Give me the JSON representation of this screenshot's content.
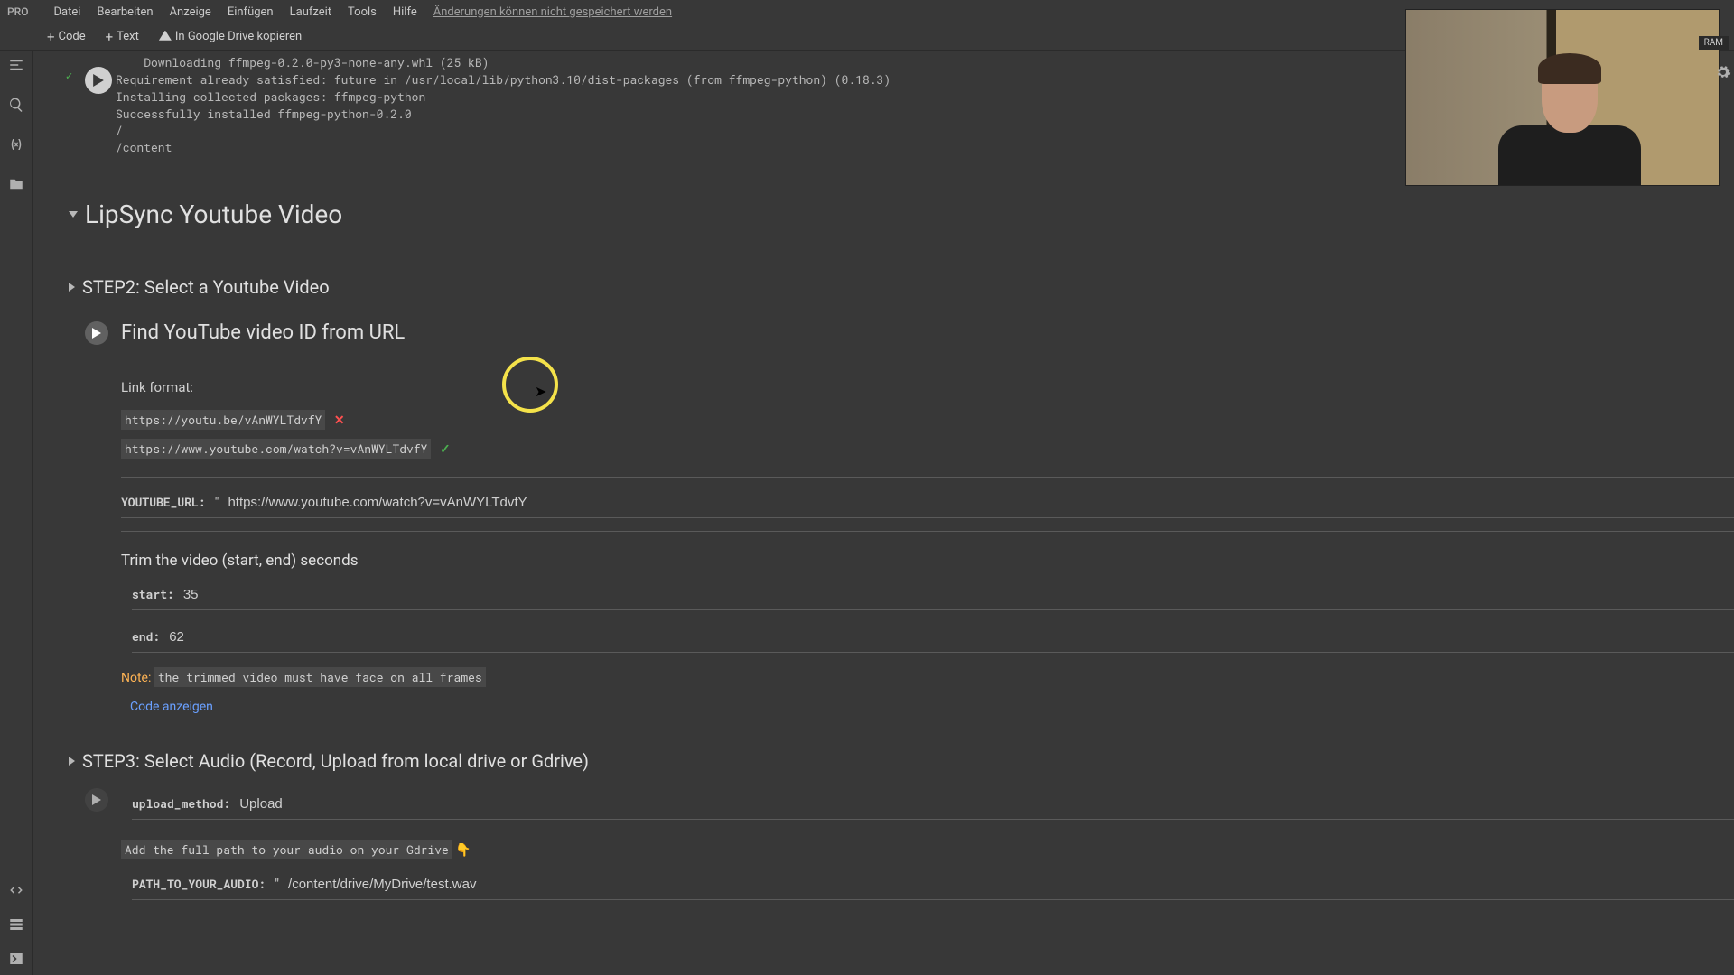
{
  "topMenu": {
    "pro": "PRO",
    "items": [
      "Datei",
      "Bearbeiten",
      "Anzeige",
      "Einfügen",
      "Laufzeit",
      "Tools",
      "Hilfe"
    ],
    "saveNotice": "Änderungen können nicht gespeichert werden"
  },
  "toolbar": {
    "code": "Code",
    "text": "Text",
    "copyDrive": "In Google Drive kopieren"
  },
  "output": {
    "lines": "    Downloading ffmpeg-0.2.0-py3-none-any.whl (25 kB)\nRequirement already satisfied: future in /usr/local/lib/python3.10/dist-packages (from ffmpeg-python) (0.18.3)\nInstalling collected packages: ffmpeg-python\nSuccessfully installed ffmpeg-python-0.2.0\n/\n/content"
  },
  "section1": {
    "title": "LipSync Youtube Video"
  },
  "step2Header": {
    "title": "STEP2: Select a Youtube Video"
  },
  "findVideo": {
    "title": "Find YouTube video ID from URL",
    "linkFormatLabel": "Link format:",
    "badLink": "https://youtu.be/vAnWYLTdvfY",
    "goodLink": "https://www.youtube.com/watch?v=vAnWYLTdvfY",
    "urlParamLabel": "YOUTUBE_URL:",
    "urlParamValue": "https://www.youtube.com/watch?v=vAnWYLTdvfY",
    "trimHeading": "Trim the video (start, end) seconds",
    "startLabel": "start:",
    "startValue": "35",
    "endLabel": "end:",
    "endValue": "62",
    "noteLabel": "Note:",
    "noteText": "the trimmed video must have face on all frames",
    "showCode": "Code anzeigen"
  },
  "step3Header": {
    "title": "STEP3: Select Audio (Record, Upload from local drive or Gdrive)"
  },
  "audioCell": {
    "uploadLabel": "upload_method:",
    "uploadValue": "Upload",
    "pathHint": "Add the full path to your audio on your Gdrive",
    "pathHintEmoji": "👇",
    "pathLabel": "PATH_TO_YOUR_AUDIO:",
    "pathValue": "/content/drive/MyDrive/test.wav"
  },
  "ramBadge": "RAM",
  "icons": {
    "x": "✕",
    "check": "✓"
  }
}
